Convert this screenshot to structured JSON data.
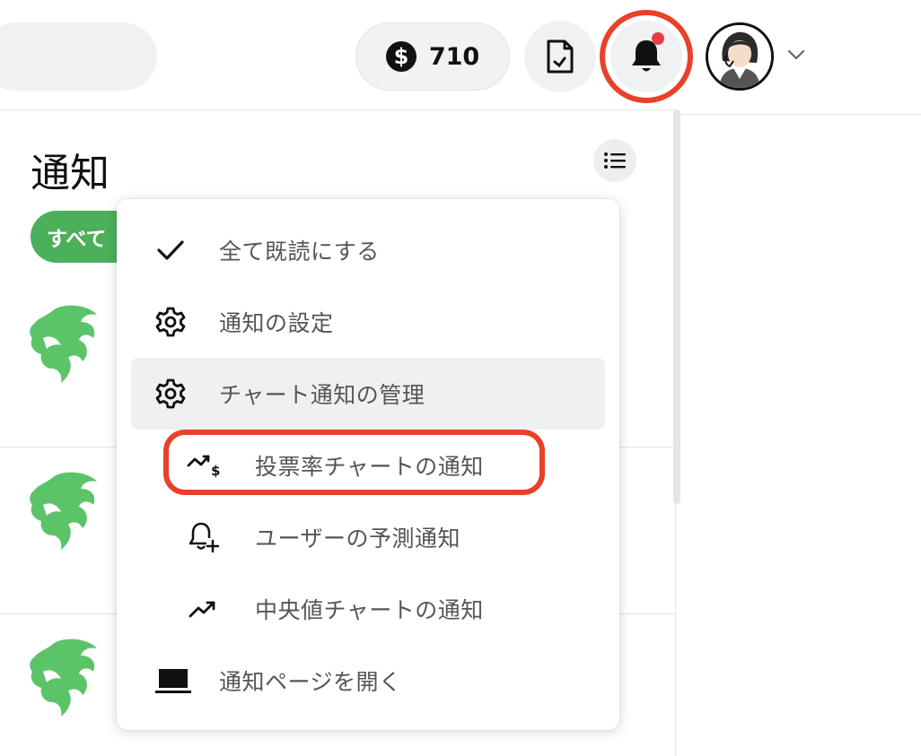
{
  "header": {
    "coin_count": "710",
    "icons": {
      "coin": "dollar-coin-icon",
      "document": "document-icon",
      "bell": "bell-icon",
      "chevron": "chevron-down-icon"
    },
    "has_unread_dot": true,
    "dot_color": "#e53e4a",
    "highlight_color": "#e8412a"
  },
  "panel": {
    "title": "通知",
    "filter_all_label": "すべて",
    "accent_color": "#4caf5a"
  },
  "menu": {
    "items": [
      {
        "label": "全て既読にする",
        "icon": "check-icon"
      },
      {
        "label": "通知の設定",
        "icon": "gear-icon"
      },
      {
        "label": "チャート通知の管理",
        "icon": "gear-icon"
      },
      {
        "label": "投票率チャートの通知",
        "icon": "trend-dollar-icon"
      },
      {
        "label": "ユーザーの予測通知",
        "icon": "bell-plus-icon"
      },
      {
        "label": "中央値チャートの通知",
        "icon": "trend-up-icon"
      },
      {
        "label": "通知ページを開く",
        "icon": "laptop-icon"
      }
    ]
  }
}
